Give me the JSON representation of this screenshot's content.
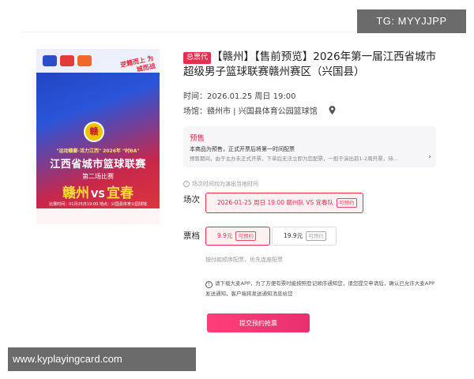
{
  "poster": {
    "slogan": "逆籍而上 为城而战",
    "emblem": "赣",
    "tagline": "\"运动赣鄱·活力江西\" 2026年 \"村BA\"",
    "league": "江西省城市篮球联赛",
    "round": "第二场比赛",
    "home_team": "赣州",
    "vs": "VS",
    "away_team": "宜春",
    "meta": "比赛时间：01月25日19:00 地点：兴国县体育公园球馆"
  },
  "event": {
    "badge": "总票代",
    "title": "【赣州】【售前预览】2026年第一届江西省城市超级男子篮球联赛赣州赛区（兴国县）",
    "time": "时间：2026.01.25 周日 19:00",
    "venue": "场馆：赣州市 | 兴国县体育公园篮球馆"
  },
  "presale": {
    "label": "预售",
    "line1": "本商品为预售，正式开票后将第一时间配票",
    "line2": "预售期间，由于主办未正式开票，下单后无法立即为您配票，一般于演出前1-2周开票，待..."
  },
  "tz_note": "场次时间均为演出当地时间",
  "session": {
    "label": "场次",
    "option": "2026-01-25 周日 19:00 赣州队 VS 宜春队",
    "tag": "可预约"
  },
  "tiers": {
    "label": "票档",
    "options": [
      {
        "price": "9.9元",
        "tag": "可预约"
      },
      {
        "price": "19.9元",
        "tag": "可预约"
      }
    ]
  },
  "order_note": "按付款顺序配票，优先连座配票",
  "warning": "请下载大麦APP，为了方便有票时能按照登记顺序通知您，请您提交申请后，确认已允许大麦APP发送通知，客户端将发送通知消息给您",
  "submit_label": "提交预约抢票",
  "watermark_top": "TG: MYYJJPP",
  "watermark_bottom": "www.kyplayingcard.com",
  "colors": {
    "accent": "#e3304f",
    "button": "#f0356f"
  }
}
